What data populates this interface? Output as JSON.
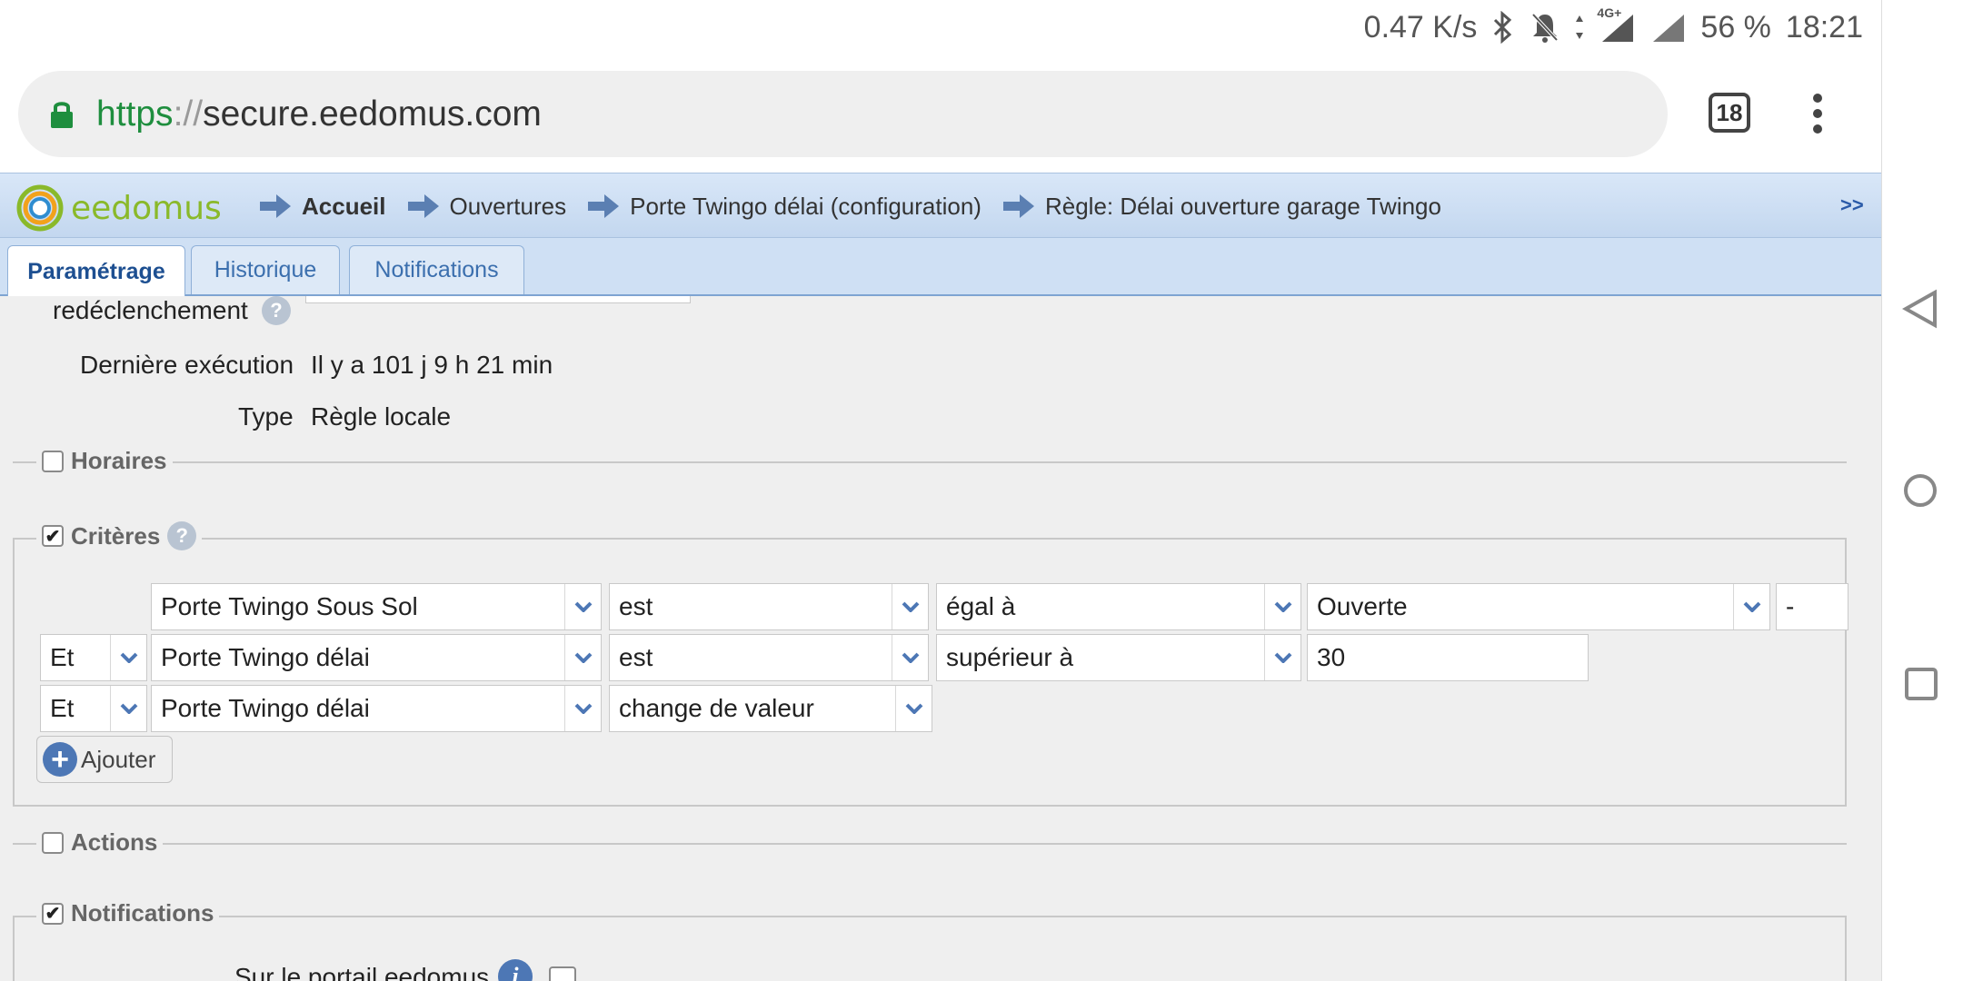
{
  "status_bar": {
    "speed": "0.47 K/s",
    "battery": "56 %",
    "time": "18:21",
    "network": "4G+",
    "icons": [
      "bluetooth-icon",
      "mute-icon",
      "data-arrows-icon",
      "signal-4g-icon",
      "signal-icon"
    ]
  },
  "browser": {
    "url_scheme": "https",
    "url_sep": "://",
    "url_host": "secure.eedomus.com",
    "tab_count": "18",
    "accent": "#1e8e3e"
  },
  "app": {
    "logo_text": "eedomus",
    "breadcrumbs": [
      "Accueil",
      "Ouvertures",
      "Porte Twingo délai (configuration)",
      "Règle: Délai ouverture garage Twingo"
    ],
    "more": ">>"
  },
  "tabs": [
    "Paramétrage",
    "Historique",
    "Notifications"
  ],
  "form": {
    "retrigger_label": "redéclenchement",
    "last_exec_label": "Dernière exécution",
    "last_exec_value": "Il y a 101 j 9 h 21 min",
    "type_label": "Type",
    "type_value": "Règle locale"
  },
  "sections": {
    "horaires": "Horaires",
    "criteres": "Critères",
    "actions": "Actions",
    "notifications": "Notifications"
  },
  "criteria": [
    {
      "conj": "",
      "device": "Porte Twingo Sous Sol",
      "verb": "est",
      "op": "égal à",
      "value": "Ouverte",
      "extra": "-"
    },
    {
      "conj": "Et",
      "device": "Porte Twingo délai",
      "verb": "est",
      "op": "supérieur à",
      "value": "30"
    },
    {
      "conj": "Et",
      "device": "Porte Twingo délai",
      "verb": "change de valeur"
    }
  ],
  "add_label": "Ajouter",
  "notif_portal_label": "Sur le portail eedomus"
}
